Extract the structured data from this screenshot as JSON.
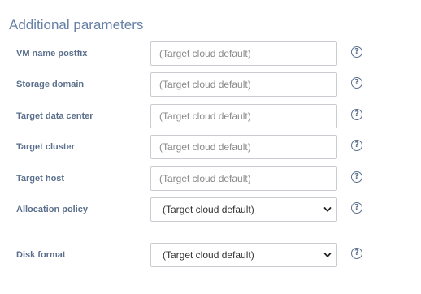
{
  "section": {
    "title": "Additional parameters"
  },
  "fields": [
    {
      "label": "VM name postfix",
      "type": "text",
      "placeholder": "(Target cloud default)",
      "value": ""
    },
    {
      "label": "Storage domain",
      "type": "text",
      "placeholder": "(Target cloud default)",
      "value": ""
    },
    {
      "label": "Target data center",
      "type": "text",
      "placeholder": "(Target cloud default)",
      "value": ""
    },
    {
      "label": "Target cluster",
      "type": "text",
      "placeholder": "(Target cloud default)",
      "value": ""
    },
    {
      "label": "Target host",
      "type": "text",
      "placeholder": "(Target cloud default)",
      "value": ""
    },
    {
      "label": "Allocation policy",
      "type": "select",
      "selected": "(Target cloud default)"
    },
    {
      "label": "Disk format",
      "type": "select",
      "selected": "(Target cloud default)"
    }
  ],
  "help": {
    "glyph": "?",
    "icon": "question-circle-icon"
  },
  "colors": {
    "title": "#6680a6",
    "label": "#5a6f8c",
    "border": "#c9cdd2",
    "placeholder": "#8a8a8a"
  }
}
